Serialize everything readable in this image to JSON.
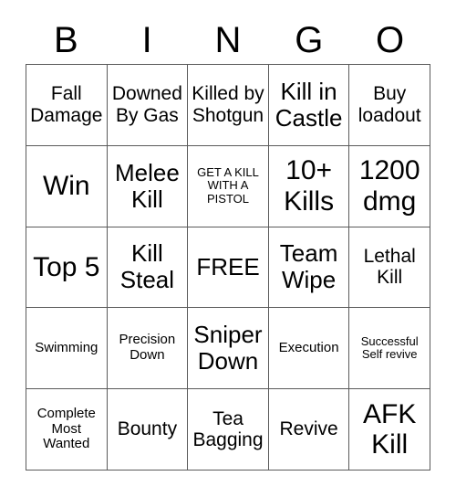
{
  "card": {
    "title": "BINGO",
    "headers": [
      "B",
      "I",
      "N",
      "G",
      "O"
    ],
    "grid_line_color": "#5a5a5a",
    "background_color": "#ffffff",
    "text_color": "#000000",
    "rows": 5,
    "columns": 5,
    "cells": [
      {
        "text": "Fall Damage",
        "size": "md",
        "free": false
      },
      {
        "text": "Downed By Gas",
        "size": "md",
        "free": false
      },
      {
        "text": "Killed by Shotgun",
        "size": "md",
        "free": false
      },
      {
        "text": "Kill in Castle",
        "size": "lg",
        "free": false
      },
      {
        "text": "Buy loadout",
        "size": "md",
        "free": false
      },
      {
        "text": "Win",
        "size": "xl",
        "free": false
      },
      {
        "text": "Melee Kill",
        "size": "lg",
        "free": false
      },
      {
        "text": "GET A KILL WITH A PISTOL",
        "size": "xs",
        "free": false
      },
      {
        "text": "10+ Kills",
        "size": "xl",
        "free": false
      },
      {
        "text": "1200 dmg",
        "size": "xl",
        "free": false
      },
      {
        "text": "Top 5",
        "size": "xl",
        "free": false
      },
      {
        "text": "Kill Steal",
        "size": "lg",
        "free": false
      },
      {
        "text": "FREE",
        "size": "lg",
        "free": true
      },
      {
        "text": "Team Wipe",
        "size": "lg",
        "free": false
      },
      {
        "text": "Lethal Kill",
        "size": "md",
        "free": false
      },
      {
        "text": "Swimming",
        "size": "sm",
        "free": false
      },
      {
        "text": "Precision Down",
        "size": "sm",
        "free": false
      },
      {
        "text": "Sniper Down",
        "size": "lg",
        "free": false
      },
      {
        "text": "Execution",
        "size": "sm",
        "free": false
      },
      {
        "text": "Successful Self revive",
        "size": "xs",
        "free": false
      },
      {
        "text": "Complete Most Wanted",
        "size": "sm",
        "free": false
      },
      {
        "text": "Bounty",
        "size": "md",
        "free": false
      },
      {
        "text": "Tea Bagging",
        "size": "md",
        "free": false
      },
      {
        "text": "Revive",
        "size": "md",
        "free": false
      },
      {
        "text": "AFK Kill",
        "size": "xl",
        "free": false
      }
    ]
  }
}
